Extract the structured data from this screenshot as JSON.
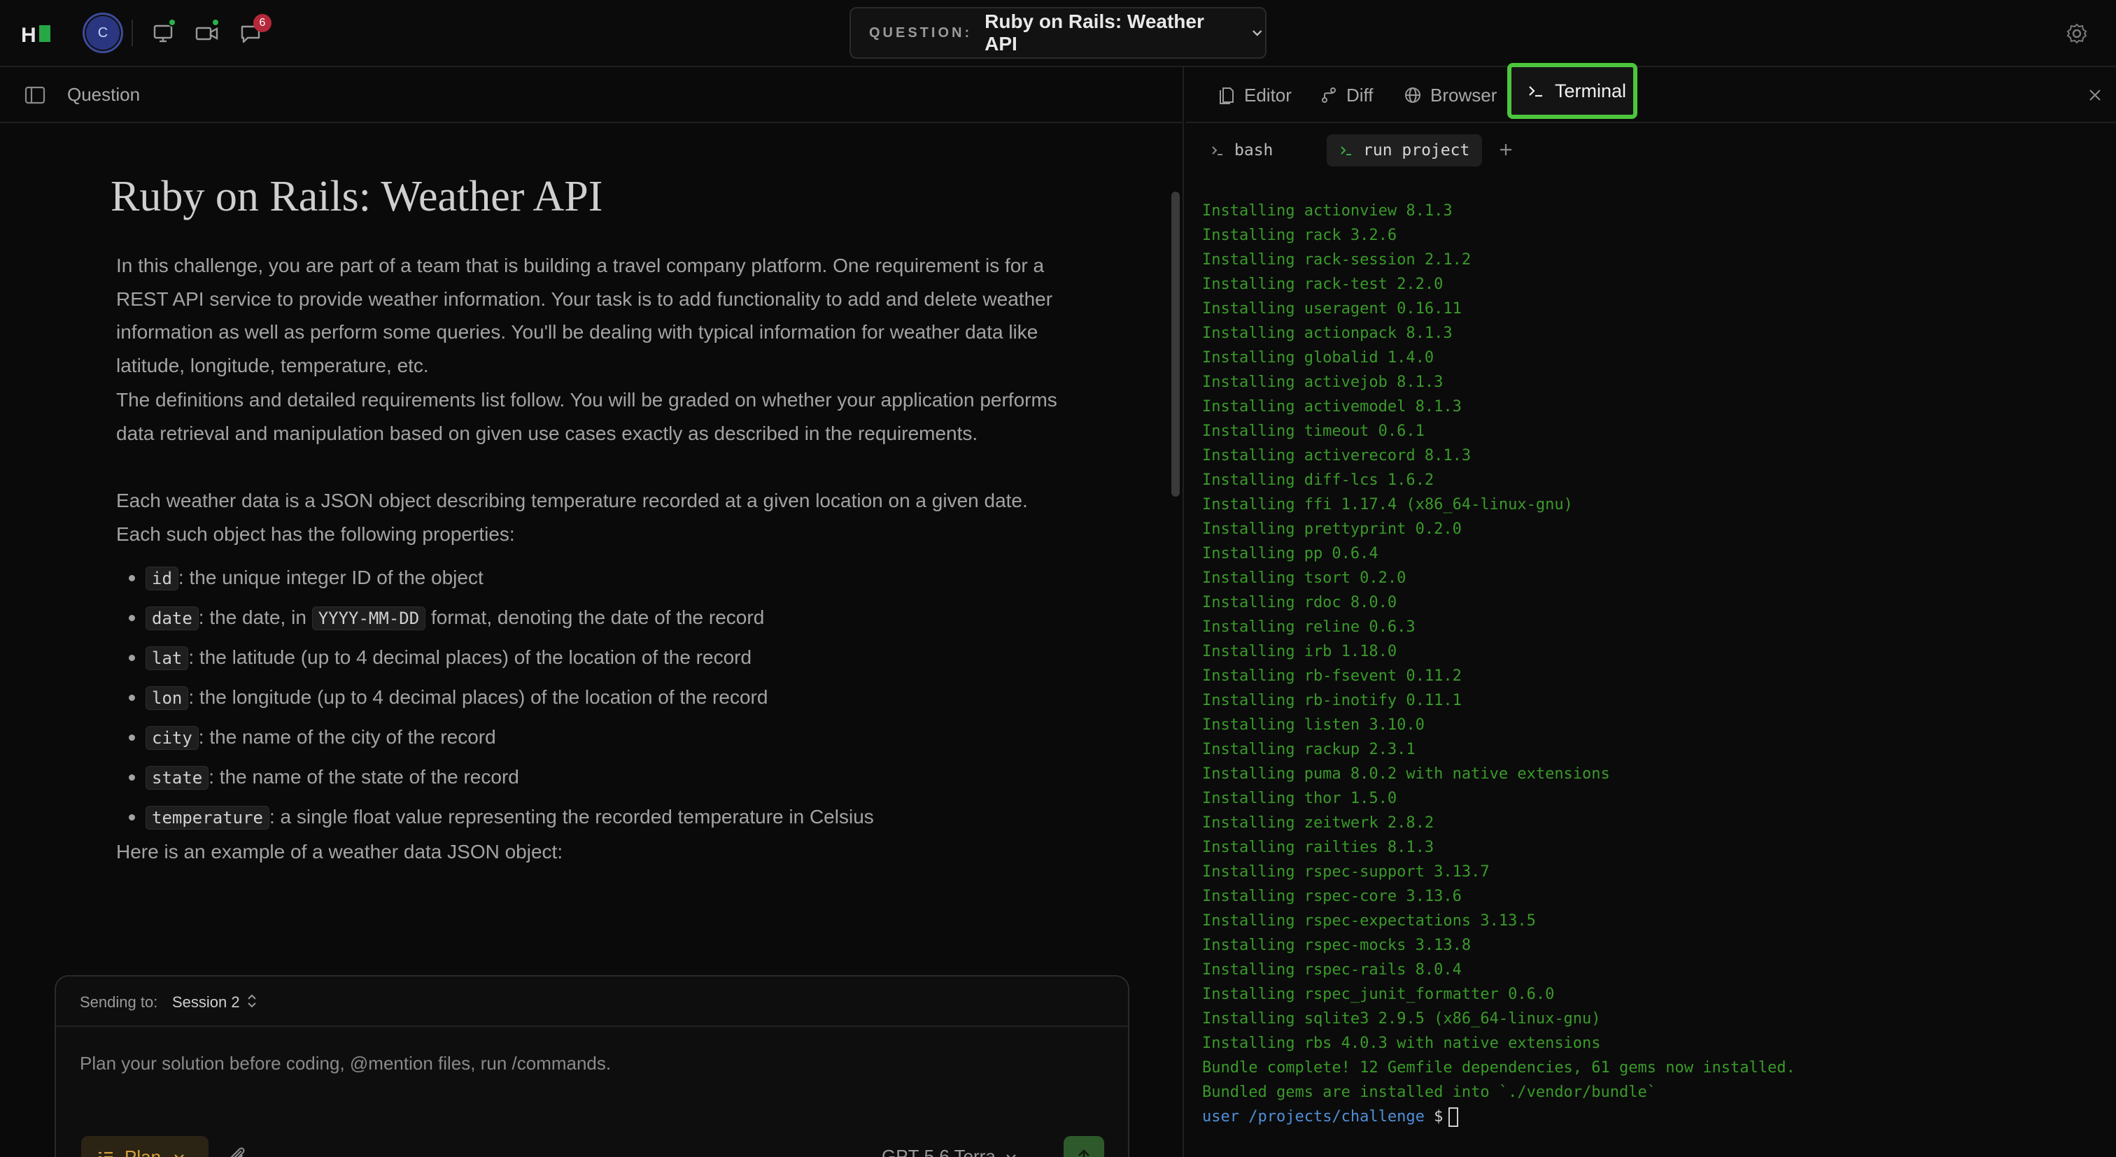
{
  "header": {
    "avatar_initial": "C",
    "notifications_count": "6",
    "question_label": "QUESTION:",
    "question_value": "Ruby on Rails: Weather API"
  },
  "left_panel": {
    "title": "Question",
    "doc_title": "Ruby on Rails: Weather API",
    "paragraphs": [
      "In this challenge, you are part of a team that is building a travel company platform. One requirement is for a REST API service to provide weather information. Your task is to add functionality to add and delete weather information as well as perform some queries. You'll be dealing with typical information for weather data like latitude, longitude, temperature, etc.",
      "The definitions and detailed requirements list follow. You will be graded on whether your application performs data retrieval and manipulation based on given use cases exactly as described in the requirements.",
      "Each weather data is a JSON object describing temperature recorded at a given location on a given date. Each such object has the following properties:"
    ],
    "properties": [
      {
        "code": "id",
        "text": ": the unique integer ID of the object"
      },
      {
        "code": "date",
        "text_before": ": the date, in ",
        "code2": "YYYY-MM-DD",
        "text": " format, denoting the date of the record"
      },
      {
        "code": "lat",
        "text": ": the latitude (up to 4 decimal places) of the location of the record"
      },
      {
        "code": "lon",
        "text": ": the longitude (up to 4 decimal places) of the location of the record"
      },
      {
        "code": "city",
        "text": ": the name of the city of the record"
      },
      {
        "code": "state",
        "text": ": the name of the state of the record"
      },
      {
        "code": "temperature",
        "text": ": a single float value representing the recorded temperature in Celsius"
      }
    ],
    "example_intro": "Here is an example of a weather data JSON object:",
    "code_first_char": "{"
  },
  "composer": {
    "sending_label": "Sending to:",
    "session": "Session 2",
    "placeholder": "Plan your solution before coding, @mention files, run /commands.",
    "mode": "Plan",
    "model": "GPT-5.6 Terra"
  },
  "right_panel": {
    "tabs": [
      "Editor",
      "Diff",
      "Browser",
      "Terminal"
    ],
    "active_tab": "Terminal",
    "subtabs": [
      "bash",
      "run project"
    ],
    "terminal_lines": [
      "Installing actionview 8.1.3",
      "Installing rack 3.2.6",
      "Installing rack-session 2.1.2",
      "Installing rack-test 2.2.0",
      "Installing useragent 0.16.11",
      "Installing actionpack 8.1.3",
      "Installing globalid 1.4.0",
      "Installing activejob 8.1.3",
      "Installing activemodel 8.1.3",
      "Installing timeout 0.6.1",
      "Installing activerecord 8.1.3",
      "Installing diff-lcs 1.6.2",
      "Installing ffi 1.17.4 (x86_64-linux-gnu)",
      "Installing prettyprint 0.2.0",
      "Installing pp 0.6.4",
      "Installing tsort 0.2.0",
      "Installing rdoc 8.0.0",
      "Installing reline 0.6.3",
      "Installing irb 1.18.0",
      "Installing rb-fsevent 0.11.2",
      "Installing rb-inotify 0.11.1",
      "Installing listen 3.10.0",
      "Installing rackup 2.3.1",
      "Installing puma 8.0.2 with native extensions",
      "Installing thor 1.5.0",
      "Installing zeitwerk 2.8.2",
      "Installing railties 8.1.3",
      "Installing rspec-support 3.13.7",
      "Installing rspec-core 3.13.6",
      "Installing rspec-expectations 3.13.5",
      "Installing rspec-mocks 3.13.8",
      "Installing rspec-rails 8.0.4",
      "Installing rspec_junit_formatter 0.6.0",
      "Installing sqlite3 2.9.5 (x86_64-linux-gnu)",
      "Installing rbs 4.0.3 with native extensions",
      "Bundle complete! 12 Gemfile dependencies, 61 gems now installed.",
      "Bundled gems are installed into `./vendor/bundle`"
    ],
    "prompt_user": "user",
    "prompt_path": "/projects/challenge",
    "prompt_symbol": "$"
  },
  "colors": {
    "accent_green": "#4cc63c",
    "terminal_green": "#3a9a2a",
    "plan_amber": "#d9a23a",
    "badge_red": "#b4283a"
  }
}
